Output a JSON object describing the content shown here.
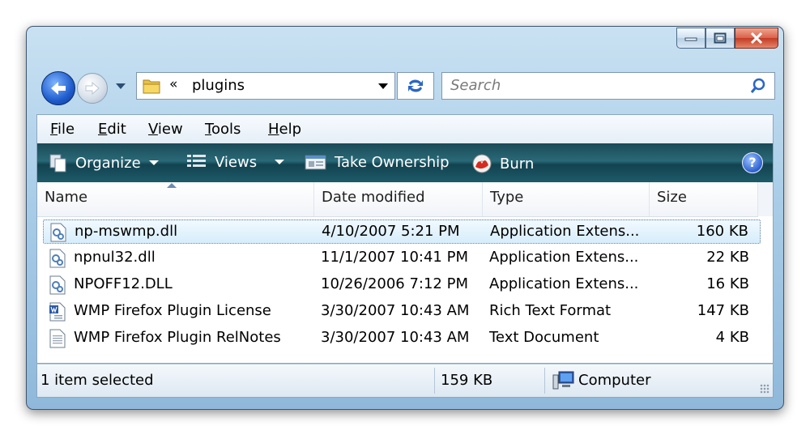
{
  "window": {
    "caption_buttons": [
      "minimize",
      "maximize",
      "close"
    ]
  },
  "address_bar": {
    "chevron": "«",
    "current_folder": "plugins"
  },
  "search": {
    "placeholder": "Search"
  },
  "menu": {
    "items": [
      {
        "label": "File",
        "accel": "F",
        "rest": "ile"
      },
      {
        "label": "Edit",
        "accel": "E",
        "rest": "dit"
      },
      {
        "label": "View",
        "accel": "V",
        "rest": "iew"
      },
      {
        "label": "Tools",
        "accel": "T",
        "rest": "ools"
      },
      {
        "label": "Help",
        "accel": "H",
        "rest": "elp"
      }
    ]
  },
  "command_bar": {
    "organize": "Organize",
    "views": "Views",
    "take_ownership": "Take Ownership",
    "burn": "Burn",
    "help": "?"
  },
  "columns": {
    "name": "Name",
    "date": "Date modified",
    "type": "Type",
    "size": "Size"
  },
  "files": [
    {
      "name": "np-mswmp.dll",
      "date": "4/10/2007 5:21 PM",
      "type": "Application Extens...",
      "size": "160 KB",
      "icon": "dll-icon",
      "selected": true
    },
    {
      "name": "npnul32.dll",
      "date": "11/1/2007 10:41 PM",
      "type": "Application Extens...",
      "size": "22 KB",
      "icon": "dll-icon",
      "selected": false
    },
    {
      "name": "NPOFF12.DLL",
      "date": "10/26/2006 7:12 PM",
      "type": "Application Extens...",
      "size": "16 KB",
      "icon": "dll-icon",
      "selected": false
    },
    {
      "name": "WMP Firefox Plugin License",
      "date": "3/30/2007 10:43 AM",
      "type": "Rich Text Format",
      "size": "147 KB",
      "icon": "rtf-icon",
      "selected": false
    },
    {
      "name": "WMP Firefox Plugin RelNotes",
      "date": "3/30/2007 10:43 AM",
      "type": "Text Document",
      "size": "4 KB",
      "icon": "txt-icon",
      "selected": false
    }
  ],
  "status": {
    "selection": "1 item selected",
    "size": "159 KB",
    "location": "Computer"
  },
  "colors": {
    "command_bar": "#1e5b6a",
    "selection": "#d6edfb",
    "frame": "#a9cde8"
  }
}
